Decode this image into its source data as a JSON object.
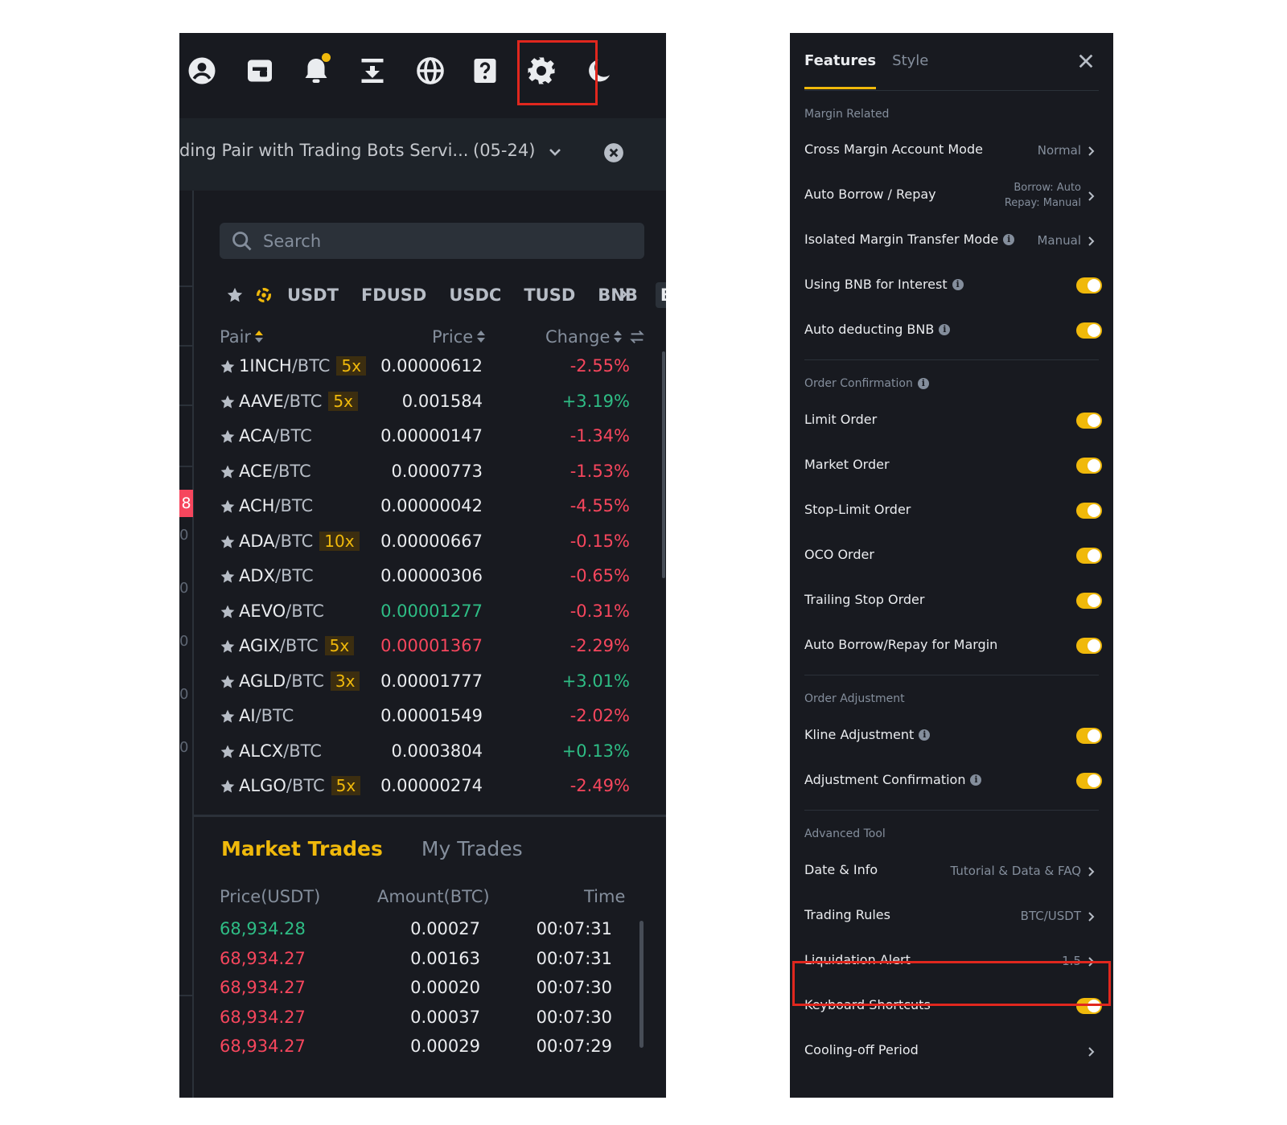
{
  "announcement": {
    "text": "ding Pair with Trading Bots Servi...",
    "date": "(05-24)"
  },
  "side_fragments": [
    "8",
    "0",
    "0",
    "0",
    "0",
    "0"
  ],
  "search": {
    "placeholder": "Search"
  },
  "quote_tabs": [
    "USDT",
    "FDUSD",
    "USDC",
    "TUSD",
    "BNB",
    "BTC"
  ],
  "active_quote_tab": "BTC",
  "pair_table": {
    "headers": {
      "pair": "Pair",
      "price": "Price",
      "change": "Change"
    },
    "rows": [
      {
        "base": "1INCH",
        "quote": "/BTC",
        "leverage": "5x",
        "price": "0.00000612",
        "change": "-2.55%"
      },
      {
        "base": "AAVE",
        "quote": "/BTC",
        "leverage": "5x",
        "price": "0.001584",
        "change": "+3.19%"
      },
      {
        "base": "ACA",
        "quote": "/BTC",
        "leverage": "",
        "price": "0.00000147",
        "change": "-1.34%"
      },
      {
        "base": "ACE",
        "quote": "/BTC",
        "leverage": "",
        "price": "0.0000773",
        "change": "-1.53%"
      },
      {
        "base": "ACH",
        "quote": "/BTC",
        "leverage": "",
        "price": "0.00000042",
        "change": "-4.55%"
      },
      {
        "base": "ADA",
        "quote": "/BTC",
        "leverage": "10x",
        "price": "0.00000667",
        "change": "-0.15%"
      },
      {
        "base": "ADX",
        "quote": "/BTC",
        "leverage": "",
        "price": "0.00000306",
        "change": "-0.65%"
      },
      {
        "base": "AEVO",
        "quote": "/BTC",
        "leverage": "",
        "price": "0.00001277",
        "change": "-0.31%",
        "price_color": "#2ebd85"
      },
      {
        "base": "AGIX",
        "quote": "/BTC",
        "leverage": "5x",
        "price": "0.00001367",
        "change": "-2.29%",
        "price_color": "#f6465d"
      },
      {
        "base": "AGLD",
        "quote": "/BTC",
        "leverage": "3x",
        "price": "0.00001777",
        "change": "+3.01%"
      },
      {
        "base": "AI",
        "quote": "/BTC",
        "leverage": "",
        "price": "0.00001549",
        "change": "-2.02%"
      },
      {
        "base": "ALCX",
        "quote": "/BTC",
        "leverage": "",
        "price": "0.0003804",
        "change": "+0.13%"
      },
      {
        "base": "ALGO",
        "quote": "/BTC",
        "leverage": "5x",
        "price": "0.00000274",
        "change": "-2.49%"
      }
    ]
  },
  "trade_tabs": {
    "market": "Market Trades",
    "mine": "My Trades"
  },
  "trades_table": {
    "headers": {
      "price": "Price(USDT)",
      "amount": "Amount(BTC)",
      "time": "Time"
    },
    "rows": [
      {
        "price": "68,934.28",
        "amount": "0.00027",
        "time": "00:07:31",
        "side": "buy"
      },
      {
        "price": "68,934.27",
        "amount": "0.00163",
        "time": "00:07:31",
        "side": "sell"
      },
      {
        "price": "68,934.27",
        "amount": "0.00020",
        "time": "00:07:30",
        "side": "sell"
      },
      {
        "price": "68,934.27",
        "amount": "0.00037",
        "time": "00:07:30",
        "side": "sell"
      },
      {
        "price": "68,934.27",
        "amount": "0.00029",
        "time": "00:07:29",
        "side": "sell"
      }
    ]
  },
  "settings_panel": {
    "tabs": {
      "features": "Features",
      "style": "Style"
    },
    "sections": {
      "margin": "Margin Related",
      "order_confirmation": "Order Confirmation",
      "order_adjustment": "Order Adjustment",
      "advanced": "Advanced Tool"
    },
    "items": {
      "cross_margin": {
        "label": "Cross Margin Account Mode",
        "value": "Normal"
      },
      "auto_borrow": {
        "label": "Auto Borrow / Repay",
        "value_line1": "Borrow: Auto",
        "value_line2": "Repay: Manual"
      },
      "isolated_transfer": {
        "label": "Isolated Margin Transfer Mode",
        "value": "Manual"
      },
      "bnb_interest": {
        "label": "Using BNB for Interest",
        "enabled": true
      },
      "auto_bnb": {
        "label": "Auto deducting BNB",
        "enabled": true
      },
      "limit_order": {
        "label": "Limit Order",
        "enabled": true
      },
      "market_order": {
        "label": "Market Order",
        "enabled": true
      },
      "stop_limit": {
        "label": "Stop-Limit Order",
        "enabled": true
      },
      "oco": {
        "label": "OCO Order",
        "enabled": true
      },
      "trailing_stop": {
        "label": "Trailing Stop Order",
        "enabled": true
      },
      "auto_borrow_margin": {
        "label": "Auto Borrow/Repay for Margin",
        "enabled": true
      },
      "kline_adjust": {
        "label": "Kline Adjustment",
        "enabled": true
      },
      "adjust_confirm": {
        "label": "Adjustment Confirmation",
        "enabled": true
      },
      "date_info": {
        "label": "Date & Info",
        "value": "Tutorial & Data & FAQ"
      },
      "trading_rules": {
        "label": "Trading Rules",
        "value": "BTC/USDT"
      },
      "liquidation_alert": {
        "label": "Liquidation Alert",
        "value": "1.5"
      },
      "keyboard": {
        "label": "Keyboard Shortcuts",
        "enabled": true
      },
      "cooling_off": {
        "label": "Cooling-off Period"
      }
    }
  },
  "colors": {
    "accent": "#f0b90b",
    "positive": "#2ebd85",
    "negative": "#f6465d",
    "highlight_box": "#e0271e"
  }
}
